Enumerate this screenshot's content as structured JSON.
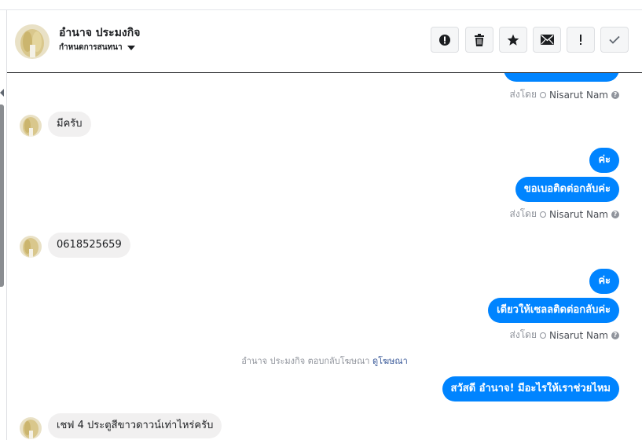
{
  "header": {
    "contact_name": "อำนาจ ประมงกิจ",
    "conversation_menu_label": "กำหนดการสนทนา"
  },
  "toolbar": {
    "buttons": [
      "spam-icon",
      "trash-icon",
      "star-icon",
      "mail-icon",
      "exclamation-icon",
      "check-icon"
    ]
  },
  "messages": [
    {
      "side": "out",
      "text": ""
    },
    {
      "side": "meta",
      "prefix": "ส่งโดย",
      "name": "Nisarut Nam"
    },
    {
      "side": "in",
      "text": "มีครับ"
    },
    {
      "side": "out",
      "text": "ค่ะ"
    },
    {
      "side": "out",
      "text": "ขอเบอติดต่อกลับค่ะ"
    },
    {
      "side": "meta",
      "prefix": "ส่งโดย",
      "name": "Nisarut Nam"
    },
    {
      "side": "in",
      "text": "0618525659"
    },
    {
      "side": "out",
      "text": "ค่ะ"
    },
    {
      "side": "out",
      "text": "เดียวให้เซลลติดต่อกลับค่ะ"
    },
    {
      "side": "meta",
      "prefix": "ส่งโดย",
      "name": "Nisarut Nam"
    },
    {
      "side": "notice",
      "text": "อำนาจ ประมงกิจ ตอบกลับโฆษณา",
      "link": "ดูโฆษณา"
    },
    {
      "side": "out",
      "text": "สวัสดี อำนาจ! มีอะไรให้เราช่วยไหม"
    },
    {
      "side": "in",
      "text": "เชฟ 4 ประตูสีขาวดาวน์เท่าไหร่ครับ"
    }
  ],
  "colors": {
    "outgoing_bubble": "#0084ff",
    "incoming_bubble": "#f1f0f0",
    "link": "#385898"
  }
}
